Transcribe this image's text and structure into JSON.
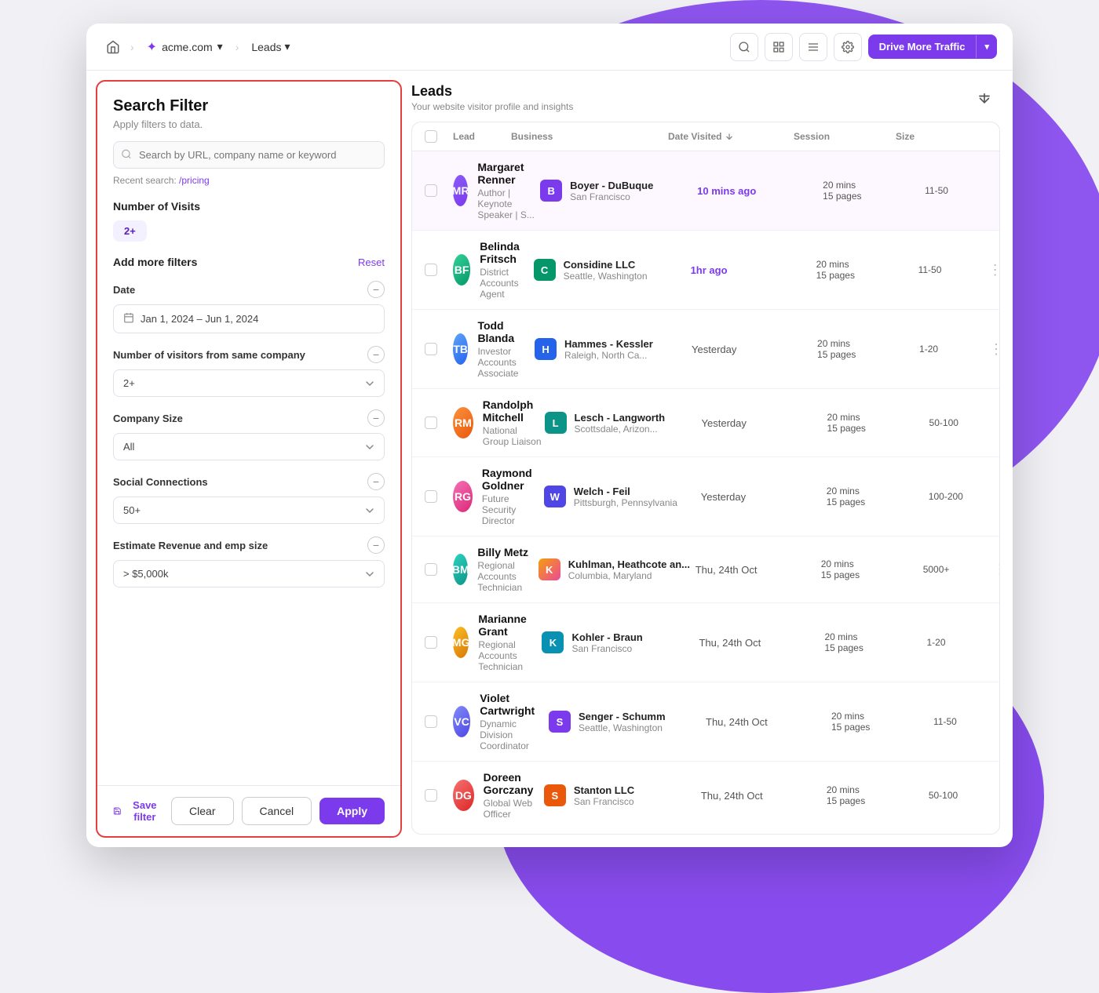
{
  "navbar": {
    "home_icon": "🏠",
    "site_name": "acme.com",
    "chevron": "›",
    "page": "Leads",
    "search_icon": "🔍",
    "grid_icon": "⊞",
    "list_icon": "☰",
    "gear_icon": "⚙",
    "drive_traffic_label": "Drive More Traffic",
    "drive_traffic_arrow": "▾"
  },
  "filter_panel": {
    "title": "Search Filter",
    "subtitle": "Apply filters to data.",
    "search_placeholder": "Search by URL, company name or keyword",
    "recent_search_prefix": "Recent search: ",
    "recent_search_link": "/pricing",
    "number_of_visits_label": "Number of Visits",
    "visits_value": "2+",
    "add_more_filters_label": "Add more filters",
    "reset_label": "Reset",
    "date_label": "Date",
    "date_value": "Jan 1, 2024 – Jun 1, 2024",
    "visitors_label": "Number of visitors from same company",
    "visitors_value": "2+",
    "company_size_label": "Company Size",
    "company_size_value": "All",
    "social_connections_label": "Social Connections",
    "social_connections_value": "50+",
    "estimate_revenue_label": "Estimate Revenue and emp size",
    "estimate_revenue_value": "> $5,000k",
    "save_filter_label": "Save filter",
    "clear_label": "Clear",
    "cancel_label": "Cancel",
    "apply_label": "Apply"
  },
  "leads": {
    "title": "Leads",
    "subtitle": "Your website visitor profile and insights",
    "sort_icon": "↓≡",
    "columns": {
      "lead": "Lead",
      "business": "Business",
      "date_visited": "Date Visited",
      "session": "Session",
      "size": "Size"
    },
    "rows": [
      {
        "name": "Margaret Renner",
        "title": "Author | Keynote Speaker | S...",
        "avatar_initials": "MR",
        "avatar_class": "av-purple",
        "biz_name": "Boyer - DuBuque",
        "biz_location": "San Francisco",
        "biz_logo_letter": "B",
        "biz_class": "biz-purple",
        "date_visited": "10 mins ago",
        "date_class": "date-highlighted",
        "session": "20 mins",
        "pages": "15 pages",
        "size": "11-50",
        "highlighted": true
      },
      {
        "name": "Belinda Fritsch",
        "title": "District Accounts Agent",
        "avatar_initials": "BF",
        "avatar_class": "av-green",
        "biz_name": "Considine LLC",
        "biz_location": "Seattle, Washington",
        "biz_logo_letter": "C",
        "biz_class": "biz-green",
        "date_visited": "1hr ago",
        "date_class": "date-highlighted",
        "session": "20 mins",
        "pages": "15 pages",
        "size": "11-50",
        "highlighted": false
      },
      {
        "name": "Todd Blanda",
        "title": "Investor Accounts Associate",
        "avatar_initials": "TB",
        "avatar_class": "av-blue",
        "biz_name": "Hammes - Kessler",
        "biz_location": "Raleigh, North Ca...",
        "biz_logo_letter": "H",
        "biz_class": "biz-blue",
        "date_visited": "Yesterday",
        "date_class": "date-normal",
        "session": "20 mins",
        "pages": "15 pages",
        "size": "1-20",
        "highlighted": false
      },
      {
        "name": "Randolph Mitchell",
        "title": "National Group Liaison",
        "avatar_initials": "RM",
        "avatar_class": "av-orange",
        "biz_name": "Lesch - Langworth",
        "biz_location": "Scottsdale, Arizon...",
        "biz_logo_letter": "L",
        "biz_class": "biz-teal",
        "date_visited": "Yesterday",
        "date_class": "date-normal",
        "session": "20 mins",
        "pages": "15 pages",
        "size": "50-100",
        "highlighted": false
      },
      {
        "name": "Raymond Goldner",
        "title": "Future Security Director",
        "avatar_initials": "RG",
        "avatar_class": "av-pink",
        "biz_name": "Welch - Feil",
        "biz_location": "Pittsburgh, Pennsylvania",
        "biz_logo_letter": "W",
        "biz_class": "biz-indigo",
        "date_visited": "Yesterday",
        "date_class": "date-normal",
        "session": "20 mins",
        "pages": "15 pages",
        "size": "100-200",
        "highlighted": false
      },
      {
        "name": "Billy Metz",
        "title": "Regional Accounts Technician",
        "avatar_initials": "BM",
        "avatar_class": "av-teal",
        "biz_name": "Kuhlman, Heathcote an...",
        "biz_location": "Columbia, Maryland",
        "biz_logo_letter": "K",
        "biz_class": "biz-multi",
        "date_visited": "Thu, 24th Oct",
        "date_class": "date-normal",
        "session": "20 mins",
        "pages": "15 pages",
        "size": "5000+",
        "highlighted": false
      },
      {
        "name": "Marianne Grant",
        "title": "Regional Accounts Technician",
        "avatar_initials": "MG",
        "avatar_class": "av-yellow",
        "biz_name": "Kohler - Braun",
        "biz_location": "San Francisco",
        "biz_logo_letter": "K",
        "biz_class": "biz-cyan",
        "date_visited": "Thu, 24th Oct",
        "date_class": "date-normal",
        "session": "20 mins",
        "pages": "15 pages",
        "size": "1-20",
        "highlighted": false
      },
      {
        "name": "Violet Cartwright",
        "title": "Dynamic Division Coordinator",
        "avatar_initials": "VC",
        "avatar_class": "av-indigo",
        "biz_name": "Senger - Schumm",
        "biz_location": "Seattle, Washington",
        "biz_logo_letter": "S",
        "biz_class": "biz-violet",
        "date_visited": "Thu, 24th Oct",
        "date_class": "date-normal",
        "session": "20 mins",
        "pages": "15 pages",
        "size": "11-50",
        "highlighted": false
      },
      {
        "name": "Doreen Gorczany",
        "title": "Global Web Officer",
        "avatar_initials": "DG",
        "avatar_class": "av-red",
        "biz_name": "Stanton LLC",
        "biz_location": "San Francisco",
        "biz_logo_letter": "S",
        "biz_class": "biz-orange",
        "date_visited": "Thu, 24th Oct",
        "date_class": "date-normal",
        "session": "20 mins",
        "pages": "15 pages",
        "size": "50-100",
        "highlighted": false
      }
    ]
  }
}
